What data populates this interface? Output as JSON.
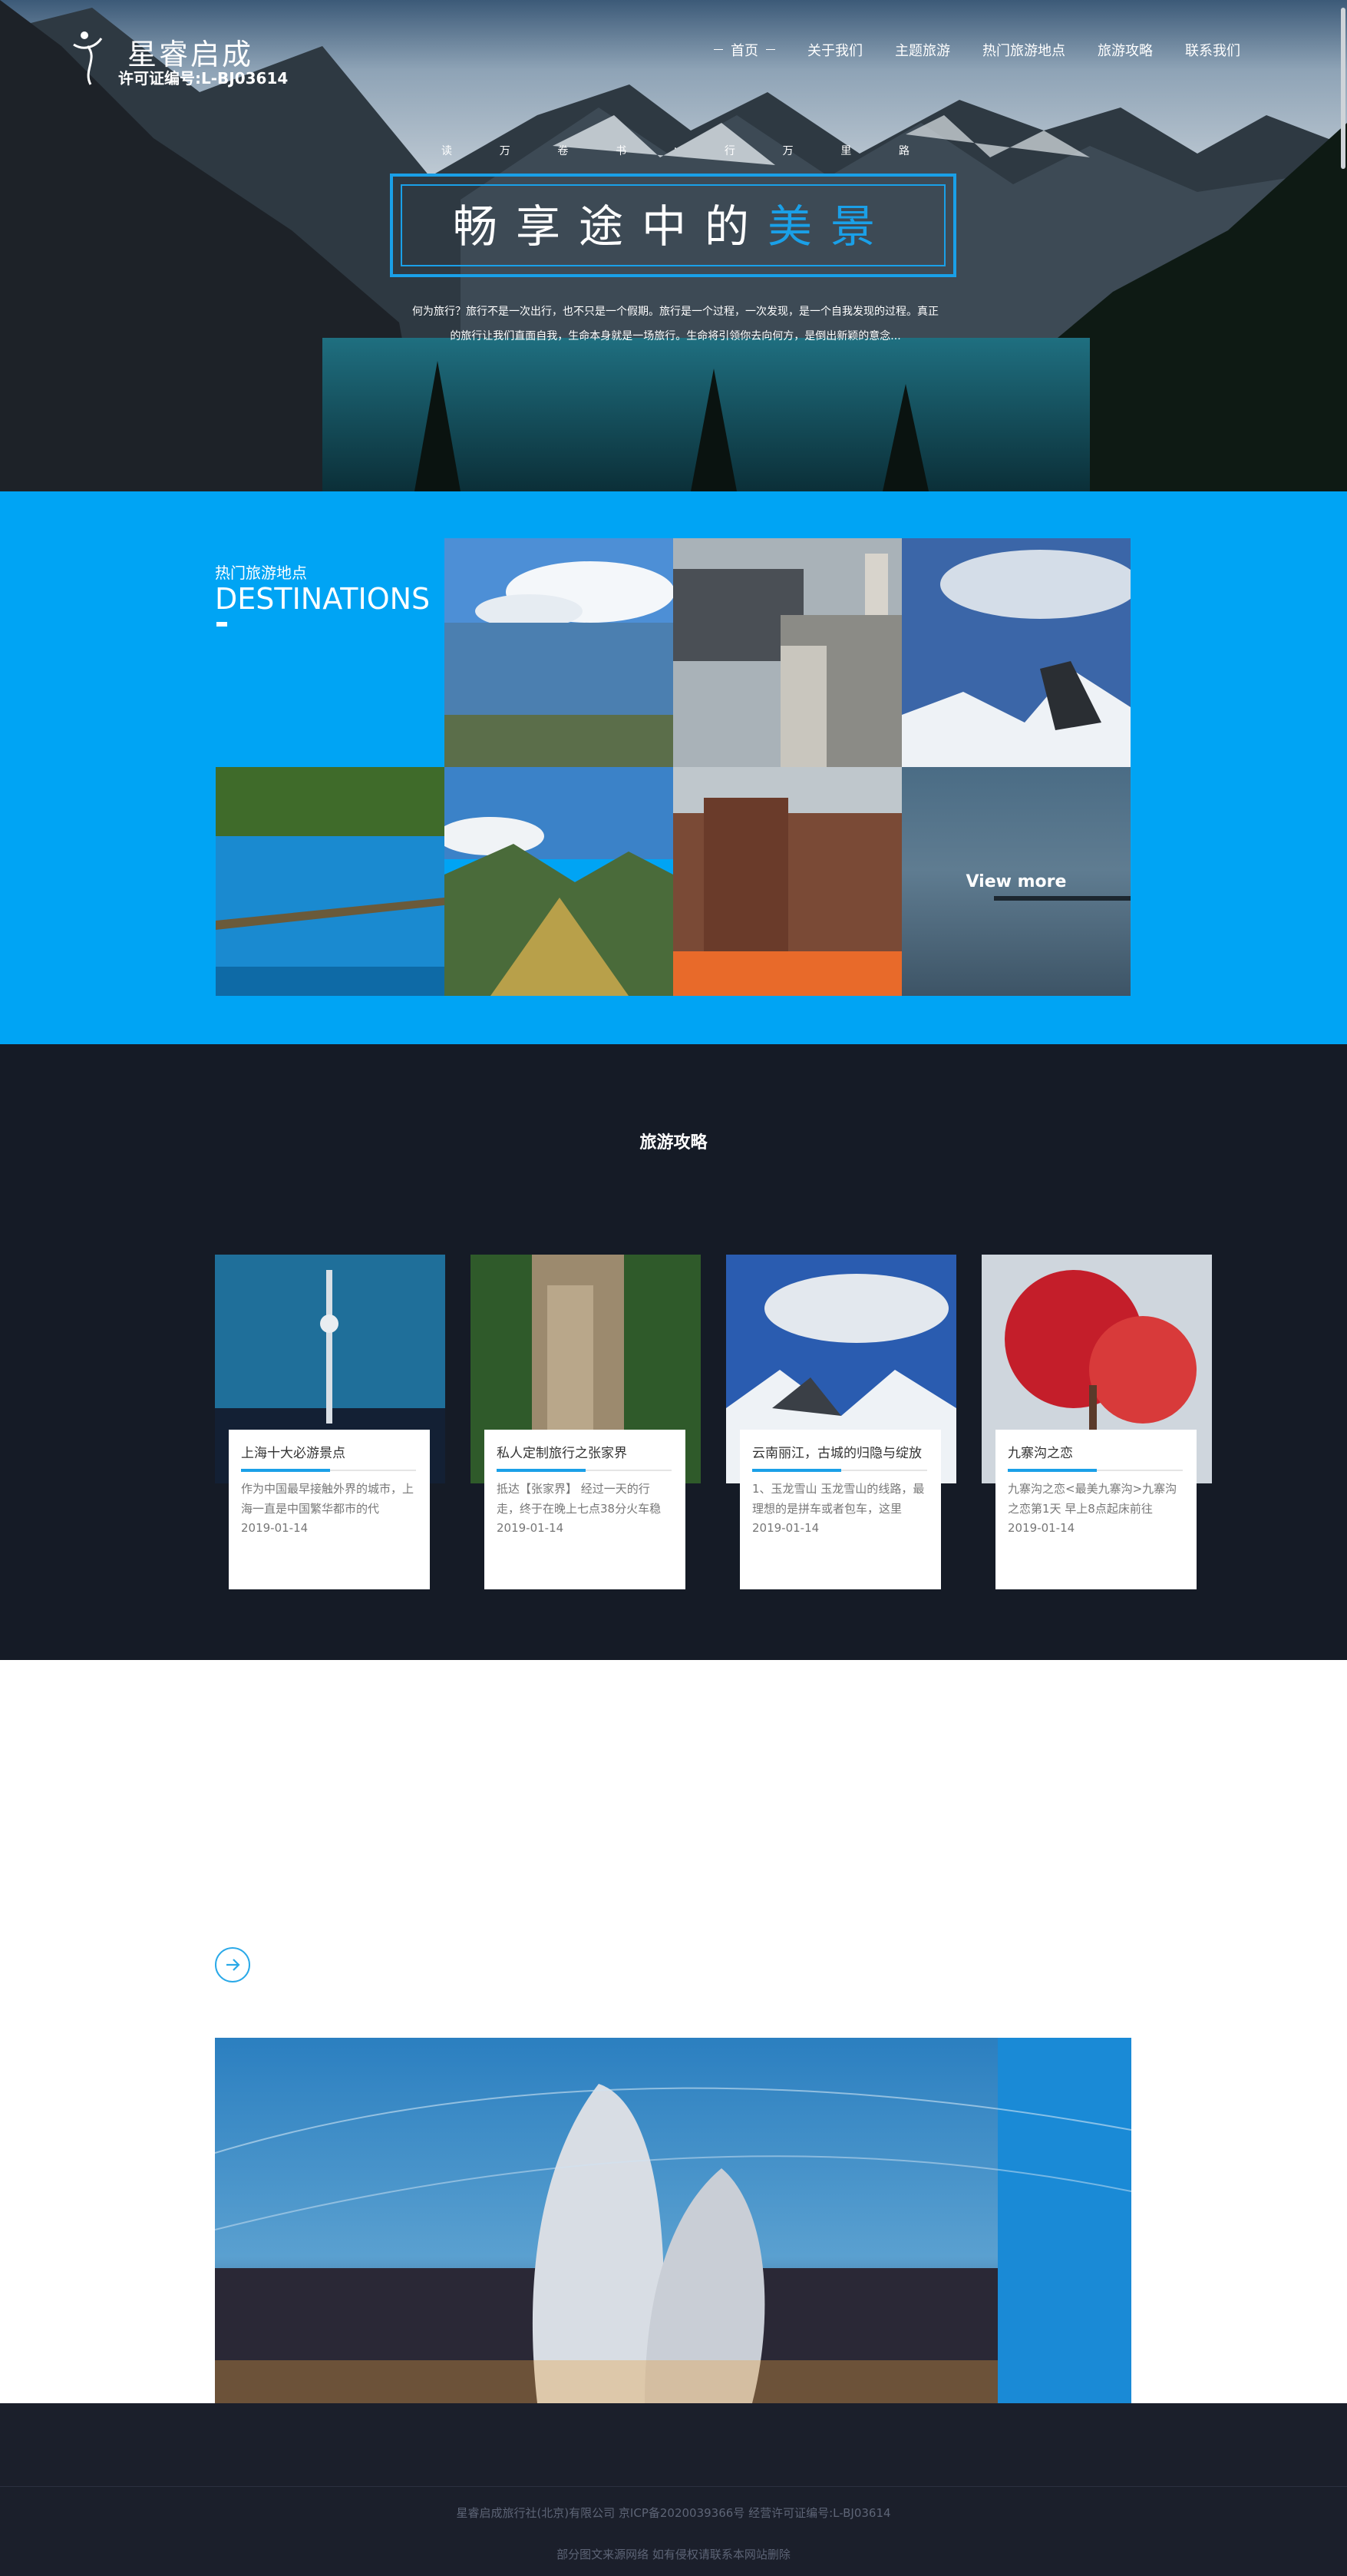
{
  "header": {
    "logo_name": "星睿启成",
    "license": "许可证编号:L-BJ03614",
    "nav": [
      "首页",
      "关于我们",
      "主题旅游",
      "热门旅游地点",
      "旅游攻略",
      "联系我们"
    ]
  },
  "hero": {
    "tagline": [
      "读",
      "万",
      "卷",
      "书",
      "·",
      "行",
      "万",
      "里",
      "路"
    ],
    "title_main": "畅享途中的",
    "title_highlight": "美景",
    "desc_line1": "何为旅行？旅行不是一次出行，也不只是一个假期。旅行是一个过程，一次发现，是一个自我发现的过程。真正",
    "desc_line2": "的旅行让我们直面自我，生命本身就是一场旅行。生命将引领你去向何方，是倒出新颖的意念..."
  },
  "destinations": {
    "title_cn": "热门旅游地点",
    "title_en": "DESTINATIONS",
    "view_more": "View more"
  },
  "guides": {
    "title": "旅游攻略",
    "cards": [
      {
        "title": "上海十大必游景点",
        "excerpt": "作为中国最早接触外界的城市，上海一直是中国繁华都市的代",
        "date": "2019-01-14"
      },
      {
        "title": "私人定制旅行之张家界",
        "excerpt": "抵达【张家界】 经过一天的行走，终于在晚上七点38分火车稳",
        "date": "2019-01-14"
      },
      {
        "title": "云南丽江，古城的归隐与绽放",
        "excerpt": "1、玉龙雪山 玉龙雪山的线路，最理想的是拼车或者包车，这里",
        "date": "2019-01-14"
      },
      {
        "title": "九寨沟之恋",
        "excerpt": "九寨沟之恋<最美九寨沟>九寨沟之恋第1天 早上8点起床前往",
        "date": "2019-01-14"
      }
    ]
  },
  "footer": {
    "line1": "星睿启成旅行社(北京)有限公司 京ICP备2020039366号 经营许可证编号:L-BJ03614",
    "line2": "部分图文来源网络 如有侵权请联系本网站删除"
  },
  "colors": {
    "accent": "#00a4f4",
    "dark": "#151b26",
    "footer": "#1b1f2b",
    "highlight": "#1aa0e8"
  }
}
